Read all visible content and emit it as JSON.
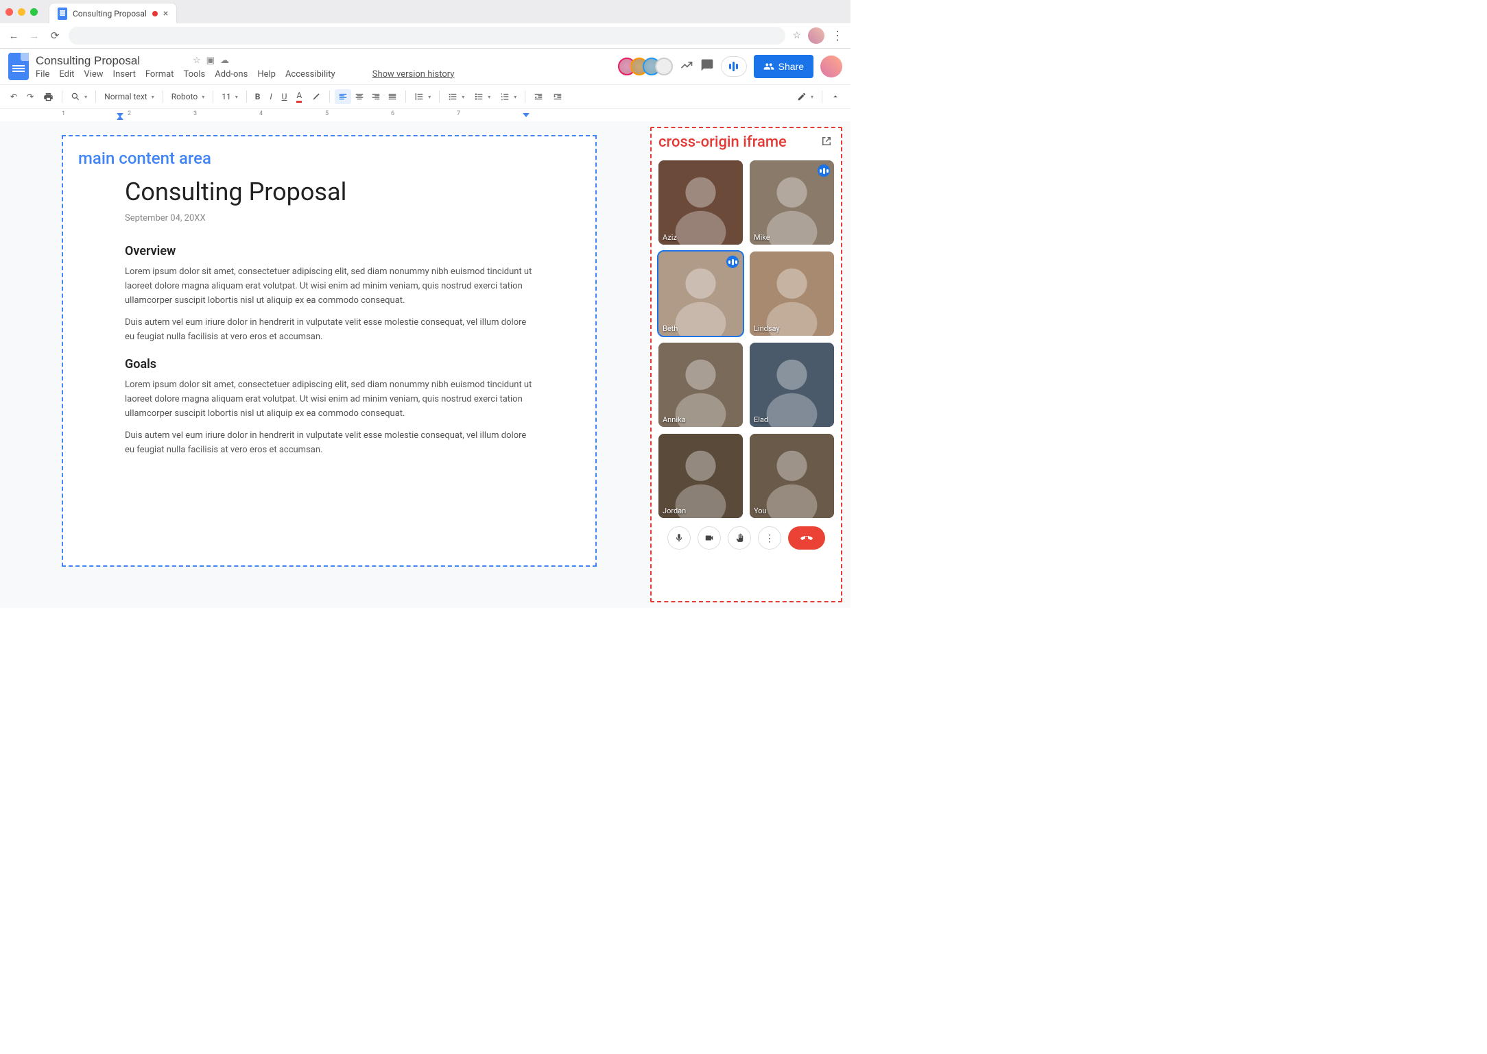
{
  "browser": {
    "tab_title": "Consulting Proposal",
    "tab_modified": true
  },
  "header": {
    "doc_title": "Consulting Proposal",
    "menus": [
      "File",
      "Edit",
      "View",
      "Insert",
      "Format",
      "Tools",
      "Add-ons",
      "Help",
      "Accessibility"
    ],
    "version_history": "Show version history",
    "share_label": "Share",
    "presence_count": 4
  },
  "toolbar": {
    "zoom": "",
    "style": "Normal text",
    "font": "Roboto",
    "size": "11"
  },
  "ruler": {
    "labels": [
      "1",
      "2",
      "3",
      "4",
      "5",
      "6",
      "7"
    ]
  },
  "annotations": {
    "main": "main content area",
    "iframe": "cross-origin iframe"
  },
  "document": {
    "title": "Consulting Proposal",
    "date": "September 04, 20XX",
    "sections": [
      {
        "heading": "Overview",
        "paragraphs": [
          "Lorem ipsum dolor sit amet, consectetuer adipiscing elit, sed diam nonummy nibh euismod tincidunt ut laoreet dolore magna aliquam erat volutpat. Ut wisi enim ad minim veniam, quis nostrud exerci tation ullamcorper suscipit lobortis nisl ut aliquip ex ea commodo consequat.",
          "Duis autem vel eum iriure dolor in hendrerit in vulputate velit esse molestie consequat, vel illum dolore eu feugiat nulla facilisis at vero eros et accumsan."
        ]
      },
      {
        "heading": "Goals",
        "paragraphs": [
          "Lorem ipsum dolor sit amet, consectetuer adipiscing elit, sed diam nonummy nibh euismod tincidunt ut laoreet dolore magna aliquam erat volutpat. Ut wisi enim ad minim veniam, quis nostrud exerci tation ullamcorper suscipit lobortis nisl ut aliquip ex ea commodo consequat.",
          "Duis autem vel eum iriure dolor in hendrerit in vulputate velit esse molestie consequat, vel illum dolore eu feugiat nulla facilisis at vero eros et accumsan."
        ]
      }
    ]
  },
  "meet": {
    "participants": [
      {
        "name": "Aziz",
        "speaking": false,
        "bg": "#6b4a3a"
      },
      {
        "name": "Mike",
        "speaking": true,
        "bg": "#8a7a6a"
      },
      {
        "name": "Beth",
        "speaking": true,
        "bg": "#b09a88",
        "outlined": true
      },
      {
        "name": "Lindsay",
        "speaking": false,
        "bg": "#a88a70"
      },
      {
        "name": "Annika",
        "speaking": false,
        "bg": "#7a6a5a"
      },
      {
        "name": "Elad",
        "speaking": false,
        "bg": "#4a5a6a"
      },
      {
        "name": "Jordan",
        "speaking": false,
        "bg": "#5a4a3a"
      },
      {
        "name": "You",
        "speaking": false,
        "bg": "#6a5a4a"
      }
    ]
  }
}
